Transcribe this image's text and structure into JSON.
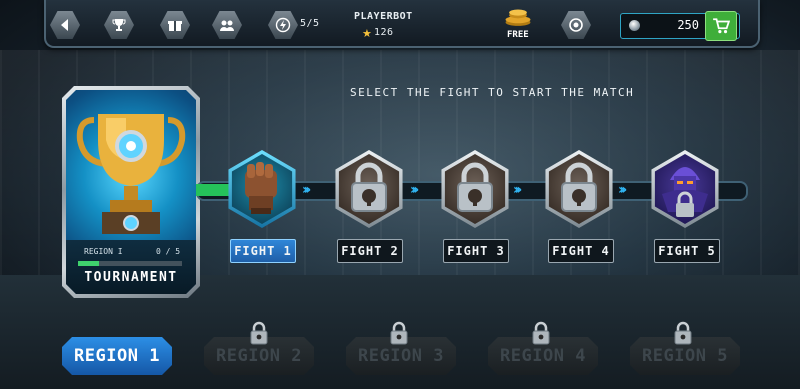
{
  "topbar": {
    "fuel": "5/5",
    "player_name": "PLAYERBOT",
    "player_rating": "126",
    "free_label": "FREE",
    "coins": "250"
  },
  "instruction": "SELECT THE FIGHT TO START THE MATCH",
  "tournament": {
    "region_label": "REGION I",
    "progress_text": "0 / 5",
    "progress": 0.2,
    "title": "TOURNAMENT"
  },
  "fights": [
    {
      "label": "FIGHT 1",
      "state": "active"
    },
    {
      "label": "FIGHT 2",
      "state": "locked"
    },
    {
      "label": "FIGHT 3",
      "state": "locked"
    },
    {
      "label": "FIGHT 4",
      "state": "locked"
    },
    {
      "label": "FIGHT 5",
      "state": "boss"
    }
  ],
  "regions": [
    {
      "label": "REGION 1",
      "state": "active"
    },
    {
      "label": "REGION 2",
      "state": "locked"
    },
    {
      "label": "REGION 3",
      "state": "locked"
    },
    {
      "label": "REGION 4",
      "state": "locked"
    },
    {
      "label": "REGION 5",
      "state": "locked"
    }
  ],
  "icons": {
    "back": "back-arrow-icon",
    "trophy": "trophy-icon",
    "gift": "gift-icon",
    "friends": "friends-icon",
    "energy": "energy-icon",
    "settings": "settings-icon",
    "cart": "cart-icon"
  },
  "colors": {
    "accent_blue": "#2c8fe6",
    "progress_green": "#25c25a",
    "cart_green": "#3fae3a",
    "star_gold": "#f5c13b"
  }
}
